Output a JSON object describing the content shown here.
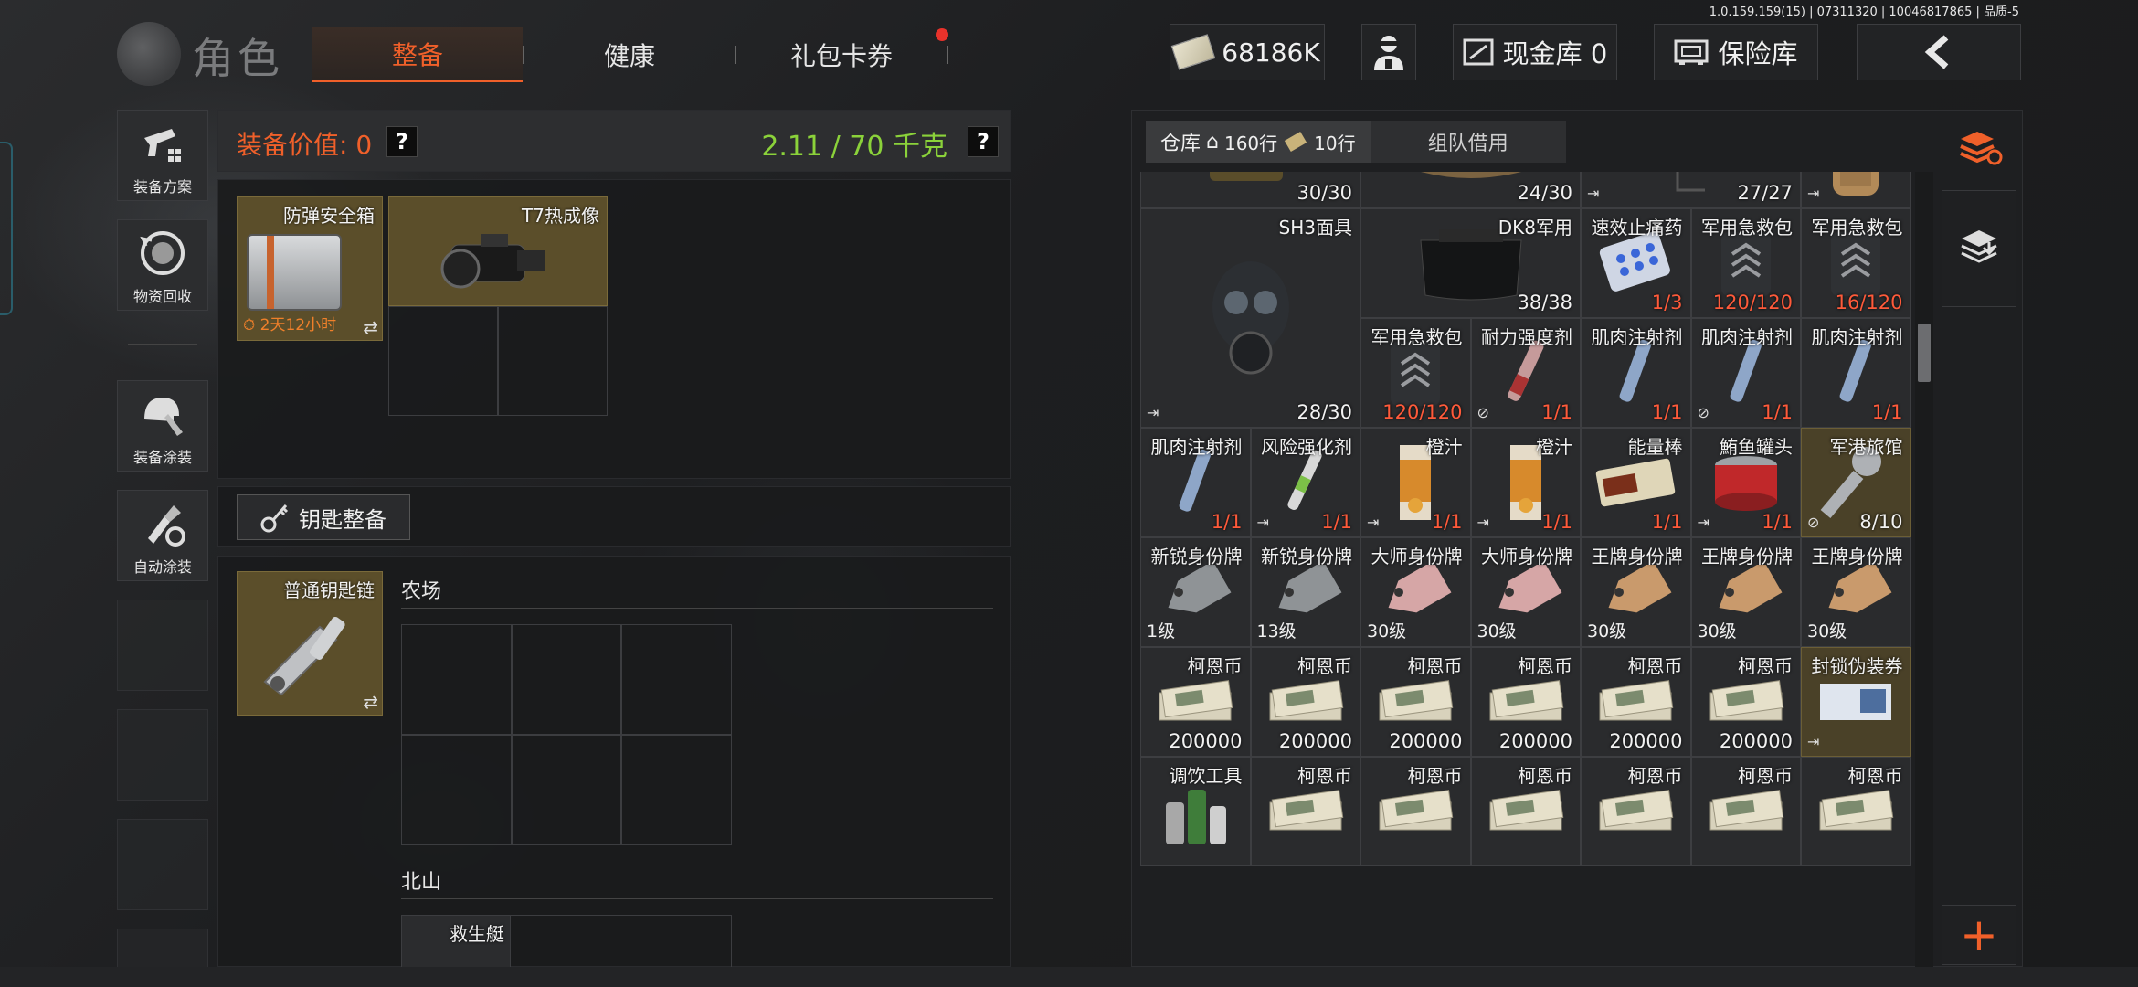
{
  "version": "1.0.159.159(15) | 07311320 | 10046817865 | 品质-5",
  "header": {
    "title": "角色",
    "tabs": [
      {
        "label": "整备",
        "active": true
      },
      {
        "label": "健康",
        "active": false
      },
      {
        "label": "礼包卡券",
        "active": false
      }
    ],
    "currency": "68186K",
    "cash_vault": "现金库 0",
    "insurance": "保险库",
    "accent": "#f0602a"
  },
  "left_menu": [
    {
      "label": "装备方案",
      "icon": "pistol-grid-icon"
    },
    {
      "label": "物资回收",
      "icon": "recycle-icon"
    },
    {
      "label": "装备涂装",
      "icon": "helmet-paint-icon"
    },
    {
      "label": "自动涂装",
      "icon": "auto-paint-icon"
    }
  ],
  "equip": {
    "value_label": "装备价值: 0",
    "weight": "2.11 / 70 千克",
    "weight_color": "#8bd23a",
    "case": {
      "name": "防弹安全箱",
      "timer": "2天12小时"
    },
    "thermal": {
      "name": "T7热成像"
    }
  },
  "keys": {
    "title": "钥匙整备",
    "keychain": "普通钥匙链",
    "area1": "农场",
    "area2": "北山",
    "area2_item": "救生艇"
  },
  "storage": {
    "tab": "仓库",
    "rows1": "160行",
    "rows2": "10行",
    "team": "组队借用"
  },
  "grid": [
    {
      "name": "",
      "count": "30/30",
      "col": 0,
      "row": 0,
      "w": 2,
      "h": 1,
      "art": "helmet-visor",
      "gold": false
    },
    {
      "name": "",
      "count": "24/30",
      "col": 2,
      "row": 0,
      "w": 2,
      "h": 1,
      "art": "helmet-camo",
      "gold": false
    },
    {
      "name": "",
      "count": "27/27",
      "col": 4,
      "row": 0,
      "w": 2,
      "h": 1,
      "art": "helmet-black",
      "gold": false,
      "exit": true
    },
    {
      "name": "",
      "count": "",
      "col": 6,
      "row": 0,
      "w": 1,
      "h": 1,
      "art": "backpack",
      "gold": false,
      "exit": true
    },
    {
      "name": "SH3面具",
      "count": "28/30",
      "col": 0,
      "row": 1,
      "w": 2,
      "h": 2,
      "art": "gasmask",
      "gold": false,
      "exit": true
    },
    {
      "name": "DK8军用",
      "count": "38/38",
      "col": 2,
      "row": 1,
      "w": 2,
      "h": 1,
      "art": "visor",
      "gold": false
    },
    {
      "name": "速效止痛药",
      "count": "1/3",
      "col": 4,
      "row": 1,
      "w": 1,
      "h": 1,
      "art": "pills",
      "red": true
    },
    {
      "name": "军用急救包",
      "count": "120/120",
      "col": 5,
      "row": 1,
      "w": 1,
      "h": 1,
      "art": "medkit",
      "red": true
    },
    {
      "name": "军用急救包",
      "count": "16/120",
      "col": 6,
      "row": 1,
      "w": 1,
      "h": 1,
      "art": "medkit",
      "red": true
    },
    {
      "name": "军用急救包",
      "count": "120/120",
      "col": 2,
      "row": 2,
      "w": 1,
      "h": 1,
      "art": "medkit",
      "red": true
    },
    {
      "name": "耐力强度剂",
      "count": "1/1",
      "col": 3,
      "row": 2,
      "w": 1,
      "h": 1,
      "art": "syringe-red",
      "red": true,
      "slash": true
    },
    {
      "name": "肌肉注射剂",
      "count": "1/1",
      "col": 4,
      "row": 2,
      "w": 1,
      "h": 1,
      "art": "syringe",
      "red": true
    },
    {
      "name": "肌肉注射剂",
      "count": "1/1",
      "col": 5,
      "row": 2,
      "w": 1,
      "h": 1,
      "art": "syringe",
      "red": true,
      "slash": true
    },
    {
      "name": "肌肉注射剂",
      "count": "1/1",
      "col": 6,
      "row": 2,
      "w": 1,
      "h": 1,
      "art": "syringe",
      "red": true
    },
    {
      "name": "肌肉注射剂",
      "count": "1/1",
      "col": 0,
      "row": 3,
      "w": 1,
      "h": 1,
      "art": "syringe",
      "red": true
    },
    {
      "name": "风险强化剂",
      "count": "1/1",
      "col": 1,
      "row": 3,
      "w": 1,
      "h": 1,
      "art": "injector",
      "red": true,
      "exit": true
    },
    {
      "name": "橙汁",
      "count": "1/1",
      "col": 2,
      "row": 3,
      "w": 1,
      "h": 1,
      "art": "juice",
      "red": true,
      "exit": true
    },
    {
      "name": "橙汁",
      "count": "1/1",
      "col": 3,
      "row": 3,
      "w": 1,
      "h": 1,
      "art": "juice",
      "red": true,
      "exit": true
    },
    {
      "name": "能量棒",
      "count": "1/1",
      "col": 4,
      "row": 3,
      "w": 1,
      "h": 1,
      "art": "bar",
      "red": true
    },
    {
      "name": "鮪鱼罐头",
      "count": "1/1",
      "col": 5,
      "row": 3,
      "w": 1,
      "h": 1,
      "art": "can",
      "red": true,
      "exit": true
    },
    {
      "name": "军港旅馆",
      "count": "8/10",
      "col": 6,
      "row": 3,
      "w": 1,
      "h": 1,
      "art": "key",
      "gold": true,
      "slash": true
    },
    {
      "name": "新锐身份牌",
      "level": "1级",
      "col": 0,
      "row": 4,
      "w": 1,
      "h": 1,
      "art": "tag-gray"
    },
    {
      "name": "新锐身份牌",
      "level": "13级",
      "col": 1,
      "row": 4,
      "w": 1,
      "h": 1,
      "art": "tag-gray"
    },
    {
      "name": "大师身份牌",
      "level": "30级",
      "col": 2,
      "row": 4,
      "w": 1,
      "h": 1,
      "art": "tag-pink"
    },
    {
      "name": "大师身份牌",
      "level": "30级",
      "col": 3,
      "row": 4,
      "w": 1,
      "h": 1,
      "art": "tag-pink"
    },
    {
      "name": "王牌身份牌",
      "level": "30级",
      "col": 4,
      "row": 4,
      "w": 1,
      "h": 1,
      "art": "tag-gold"
    },
    {
      "name": "王牌身份牌",
      "level": "30级",
      "col": 5,
      "row": 4,
      "w": 1,
      "h": 1,
      "art": "tag-gold"
    },
    {
      "name": "王牌身份牌",
      "level": "30级",
      "col": 6,
      "row": 4,
      "w": 1,
      "h": 1,
      "art": "tag-gold"
    },
    {
      "name": "柯恩币",
      "count": "200000",
      "col": 0,
      "row": 5,
      "w": 1,
      "h": 1,
      "art": "cash"
    },
    {
      "name": "柯恩币",
      "count": "200000",
      "col": 1,
      "row": 5,
      "w": 1,
      "h": 1,
      "art": "cash"
    },
    {
      "name": "柯恩币",
      "count": "200000",
      "col": 2,
      "row": 5,
      "w": 1,
      "h": 1,
      "art": "cash"
    },
    {
      "name": "柯恩币",
      "count": "200000",
      "col": 3,
      "row": 5,
      "w": 1,
      "h": 1,
      "art": "cash"
    },
    {
      "name": "柯恩币",
      "count": "200000",
      "col": 4,
      "row": 5,
      "w": 1,
      "h": 1,
      "art": "cash"
    },
    {
      "name": "柯恩币",
      "count": "200000",
      "col": 5,
      "row": 5,
      "w": 1,
      "h": 1,
      "art": "cash"
    },
    {
      "name": "封锁伪装券",
      "count": "",
      "col": 6,
      "row": 5,
      "w": 1,
      "h": 1,
      "art": "ticket",
      "gold": true,
      "exit": true
    },
    {
      "name": "调饮工具",
      "count": "",
      "col": 0,
      "row": 6,
      "w": 1,
      "h": 1,
      "art": "bottles"
    },
    {
      "name": "柯恩币",
      "count": "",
      "col": 1,
      "row": 6,
      "w": 1,
      "h": 1,
      "art": "cash"
    },
    {
      "name": "柯恩币",
      "count": "",
      "col": 2,
      "row": 6,
      "w": 1,
      "h": 1,
      "art": "cash"
    },
    {
      "name": "柯恩币",
      "count": "",
      "col": 3,
      "row": 6,
      "w": 1,
      "h": 1,
      "art": "cash"
    },
    {
      "name": "柯恩币",
      "count": "",
      "col": 4,
      "row": 6,
      "w": 1,
      "h": 1,
      "art": "cash"
    },
    {
      "name": "柯恩币",
      "count": "",
      "col": 5,
      "row": 6,
      "w": 1,
      "h": 1,
      "art": "cash"
    },
    {
      "name": "柯恩币",
      "count": "",
      "col": 6,
      "row": 6,
      "w": 1,
      "h": 1,
      "art": "cash"
    }
  ]
}
